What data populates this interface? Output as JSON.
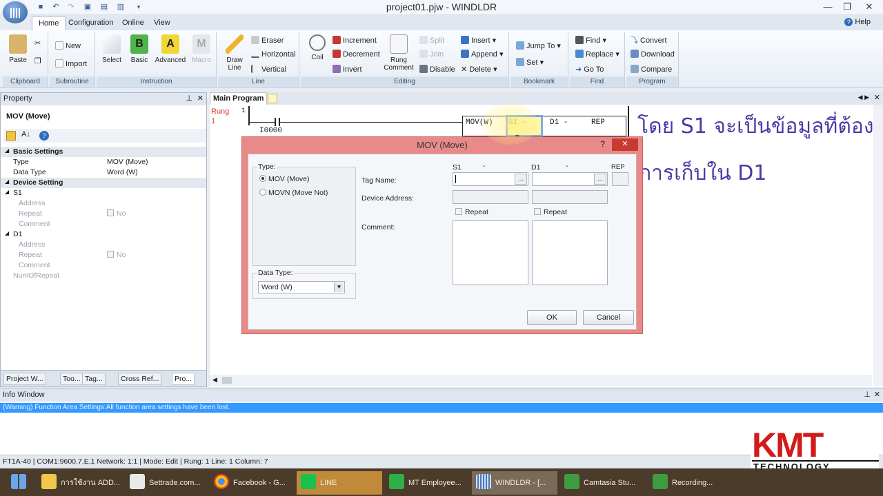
{
  "window": {
    "title": "project01.pjw - WINDLDR",
    "controls": [
      "—",
      "❐",
      "✕"
    ]
  },
  "quick_access": [
    "save-icon",
    "undo-icon",
    "redo-icon",
    "new-icon",
    "open-icon",
    "print-icon",
    "dropdown-icon"
  ],
  "menu_tabs": [
    "Home",
    "Configuration",
    "Online",
    "View"
  ],
  "help_label": "Help",
  "ribbon": {
    "clipboard": {
      "label": "Clipboard",
      "paste": "Paste"
    },
    "subroutine": {
      "label": "Subroutine",
      "new": "New",
      "import": "Import"
    },
    "instruction": {
      "label": "Instruction",
      "select": "Select",
      "basic": "Basic",
      "advanced": "Advanced",
      "macro": "Macro"
    },
    "line": {
      "label": "Line",
      "draw_line": "Draw Line",
      "eraser": "Eraser",
      "horizontal": "Horizontal",
      "vertical": "Vertical"
    },
    "editing": {
      "label": "Editing",
      "coil": "Coil",
      "increment": "Increment",
      "decrement": "Decrement",
      "invert": "Invert",
      "rung_comment": "Rung Comment",
      "split": "Split",
      "join": "Join",
      "disable": "Disable",
      "insert": "Insert",
      "append": "Append",
      "delete": "Delete"
    },
    "bookmark": {
      "label": "Bookmark",
      "jump_to": "Jump To",
      "set": "Set"
    },
    "find": {
      "label": "Find",
      "find": "Find",
      "replace": "Replace",
      "go_to": "Go To"
    },
    "program": {
      "label": "Program",
      "convert": "Convert",
      "download": "Download",
      "compare": "Compare"
    }
  },
  "property_panel": {
    "header": "Property",
    "title": "MOV (Move)",
    "rows": [
      {
        "type": "cat",
        "key": "Basic Settings",
        "value": ""
      },
      {
        "type": "item",
        "key": "Type",
        "value": "MOV (Move)"
      },
      {
        "type": "item",
        "key": "Data Type",
        "value": "Word (W)"
      },
      {
        "type": "cat",
        "key": "Device Setting",
        "value": ""
      },
      {
        "type": "sub",
        "key": "S1",
        "value": ""
      },
      {
        "type": "gray",
        "key": "Address",
        "value": ""
      },
      {
        "type": "gray",
        "key": "Repeat",
        "value": "No"
      },
      {
        "type": "gray",
        "key": "Comment",
        "value": ""
      },
      {
        "type": "sub",
        "key": "D1",
        "value": ""
      },
      {
        "type": "gray",
        "key": "Address",
        "value": ""
      },
      {
        "type": "gray",
        "key": "Repeat",
        "value": "No"
      },
      {
        "type": "gray",
        "key": "Comment",
        "value": ""
      },
      {
        "type": "gray",
        "key": "NumOfRepeat",
        "value": ""
      }
    ],
    "tabs": [
      "Project W...",
      "Too...",
      "Tag...",
      "Cross Ref...",
      "Pro..."
    ]
  },
  "main_program": {
    "tab": "Main Program",
    "rung_label": "Rung",
    "rung_num": "1",
    "line_num": "1",
    "col_num": "1",
    "contact": "I0000",
    "instr": {
      "name": "MOV(W)",
      "s1": "S1 -",
      "d1": "D1 -",
      "rep": "REP"
    }
  },
  "overlay_text": [
    "โดย S1 จะเป็นข้อมูลที่ต้อง",
    "การเก็บใน D1"
  ],
  "dialog": {
    "title": "MOV (Move)",
    "type_label": "Type:",
    "type_options": [
      {
        "label": "MOV (Move)",
        "selected": true
      },
      {
        "label": "MOVN (Move Not)",
        "selected": false
      }
    ],
    "data_type_label": "Data Type:",
    "data_type_value": "Word (W)",
    "col_s1": "S1",
    "col_s1_dash": "-",
    "col_d1": "D1",
    "col_d1_dash": "-",
    "col_rep": "REP",
    "tag_name_label": "Tag Name:",
    "device_address_label": "Device Address:",
    "comment_label": "Comment:",
    "repeat_label": "Repeat",
    "browse": "...",
    "ok": "OK",
    "cancel": "Cancel",
    "help": "?",
    "close": "✕"
  },
  "info_window": {
    "header": "Info Window",
    "message": "(Warning) Function Area Settings:All function area settings have been lost."
  },
  "status_bar": "FT1A-40  | COM1:9600,7,E,1 Network: 1:1 | Mode: Edit | Rung: 1  Line: 1  Column: 7",
  "logo": {
    "text": "KMT",
    "sub": "TECHNOLOGY"
  },
  "taskbar": [
    {
      "label": "",
      "icon": "windows-start-icon",
      "color": "#6aa6e8"
    },
    {
      "label": "การใช้งาน ADD...",
      "icon": "folder-icon",
      "color": "#f0c84a"
    },
    {
      "label": "Settrade.com...",
      "icon": "document-icon",
      "color": "#e9e9e9"
    },
    {
      "label": "Facebook - G...",
      "icon": "chrome-icon",
      "color": "#dd4433"
    },
    {
      "label": "LINE",
      "icon": "line-app-icon",
      "color": "#19c24a"
    },
    {
      "label": "MT Employee...",
      "icon": "people-icon",
      "color": "#2fae4a"
    },
    {
      "label": "WINDLDR - [...",
      "icon": "windldr-icon",
      "color": "#4b77bb"
    },
    {
      "label": "Camtasia Stu...",
      "icon": "camtasia-icon",
      "color": "#3f9b3f"
    },
    {
      "label": "Recording...",
      "icon": "recording-icon",
      "color": "#3f9b3f"
    }
  ],
  "colors": {
    "accent": "#3399ff",
    "dialog_border": "#e98a8a",
    "thai_text": "#4a3aa8",
    "logo_red": "#d11b1b"
  }
}
